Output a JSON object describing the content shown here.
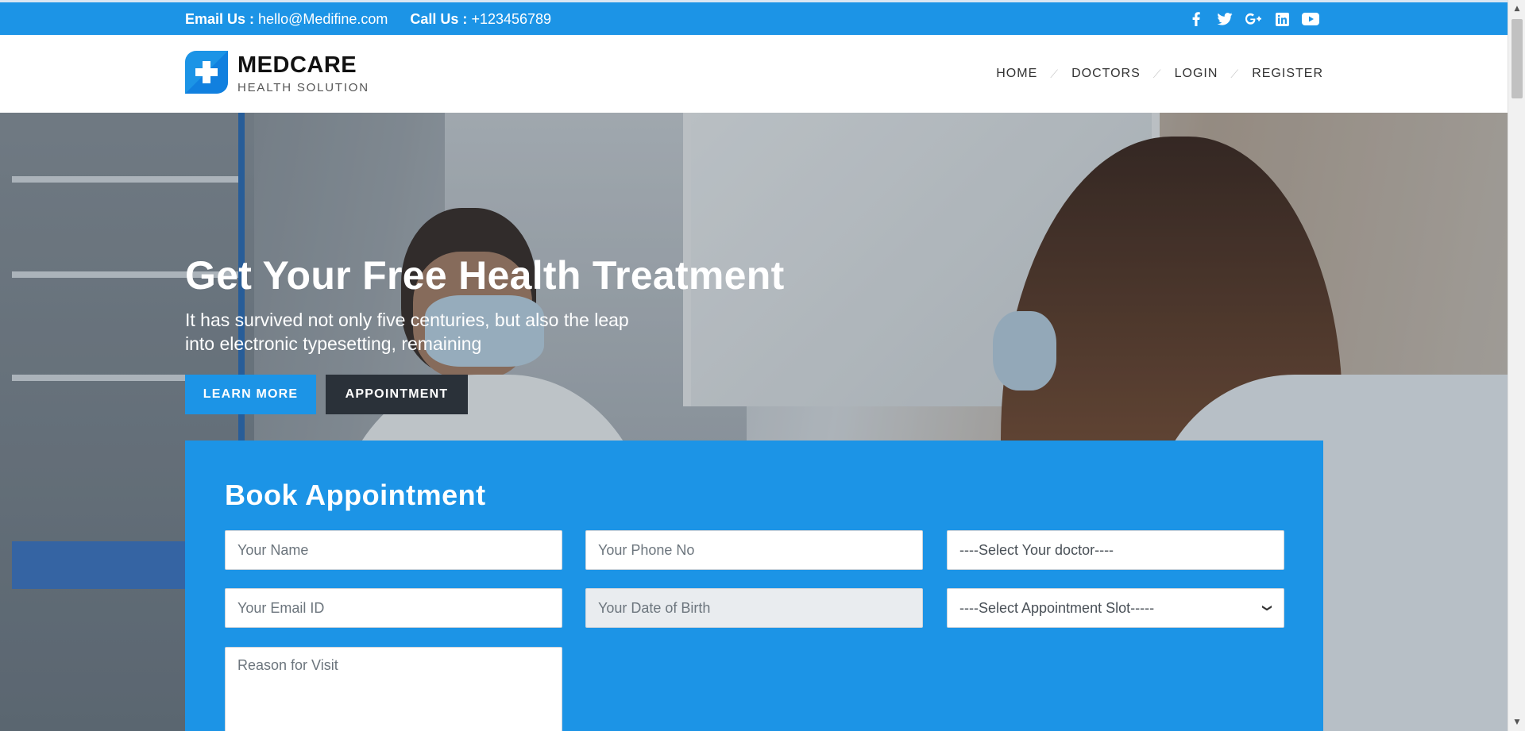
{
  "topbar": {
    "email_label": "Email Us :",
    "email_value": "hello@Medifine.com",
    "call_label": "Call Us :",
    "call_value": "+123456789",
    "social": [
      "facebook-icon",
      "twitter-icon",
      "google-plus-icon",
      "linkedin-icon",
      "youtube-icon"
    ]
  },
  "brand": {
    "name": "MEDCARE",
    "tagline": "HEALTH SOLUTION",
    "color": "#1c94e6"
  },
  "nav": {
    "items": [
      "HOME",
      "DOCTORS",
      "LOGIN",
      "REGISTER"
    ],
    "separator": "⟋"
  },
  "hero": {
    "title": "Get Your Free Health Treatment",
    "subtitle": "It has survived not only five centuries, but also the leap into electronic typesetting, remaining",
    "learn_more": "LEARN MORE",
    "appointment": "APPOINTMENT"
  },
  "appointment_form": {
    "title": "Book Appointment",
    "name_placeholder": "Your Name",
    "phone_placeholder": "Your Phone No",
    "doctor_select": "----Select Your doctor----",
    "email_placeholder": "Your Email ID",
    "dob_placeholder": "Your Date of Birth",
    "slot_select": "----Select Appointment Slot-----",
    "reason_placeholder": "Reason for Visit"
  },
  "colors": {
    "primary": "#1c94e6",
    "dark": "#2a3139"
  }
}
